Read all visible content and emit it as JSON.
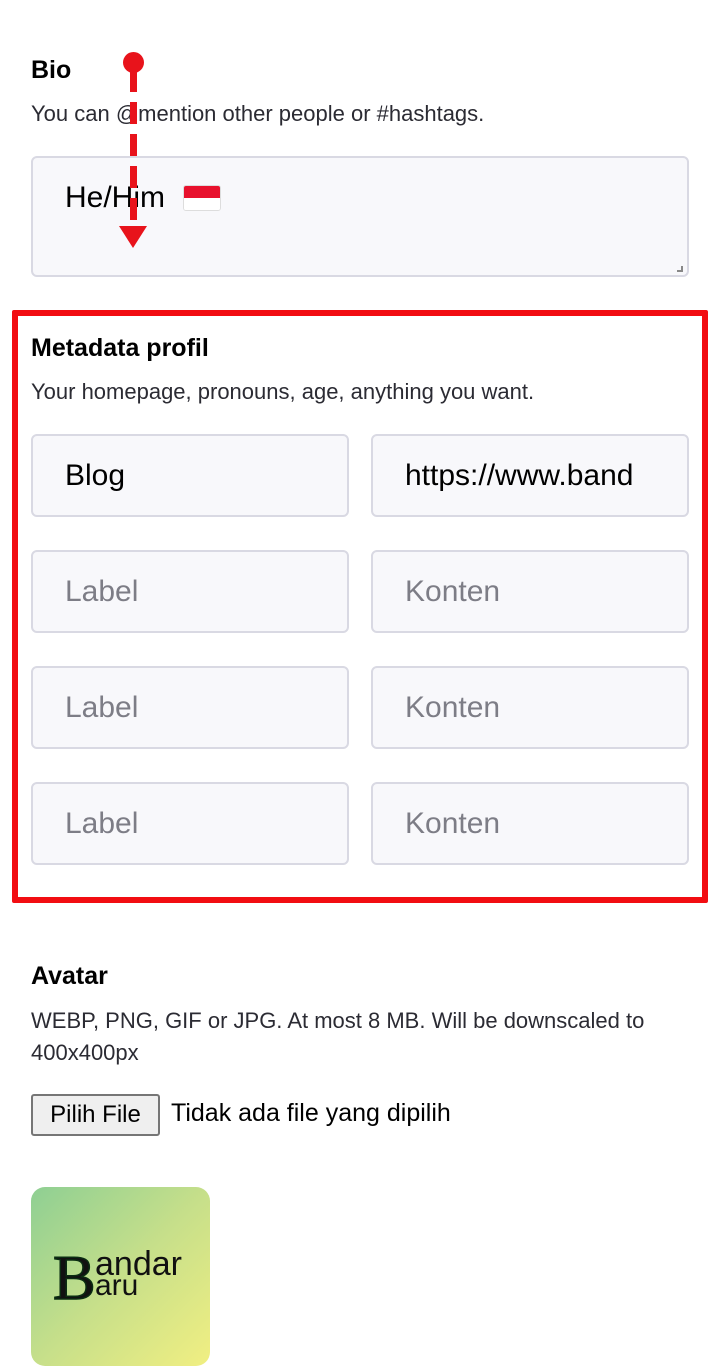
{
  "bio": {
    "title": "Bio",
    "hint": "You can @mention other people or #hashtags.",
    "value": "He/Him",
    "flag_icon": "indonesia-flag-emoji"
  },
  "metadata": {
    "title": "Metadata profil",
    "hint": "Your homepage, pronouns, age, anything you want.",
    "rows": [
      {
        "label": "Blog",
        "content": "https://www.band",
        "label_placeholder": "Label",
        "content_placeholder": "Konten"
      },
      {
        "label": "",
        "content": "",
        "label_placeholder": "Label",
        "content_placeholder": "Konten"
      },
      {
        "label": "",
        "content": "",
        "label_placeholder": "Label",
        "content_placeholder": "Konten"
      },
      {
        "label": "",
        "content": "",
        "label_placeholder": "Label",
        "content_placeholder": "Konten"
      }
    ]
  },
  "avatar": {
    "title": "Avatar",
    "hint": "WEBP, PNG, GIF or JPG. At most 8 MB. Will be downscaled to 400x400px",
    "file_button": "Pilih File",
    "file_status": "Tidak ada file yang dipilih",
    "logo_text_b": "B",
    "logo_text_line1": "andar",
    "logo_text_line2": "aru"
  },
  "annotation": {
    "highlight_color": "#f20d12",
    "arrow_color": "#e8131b",
    "arrow_direction": "down"
  }
}
